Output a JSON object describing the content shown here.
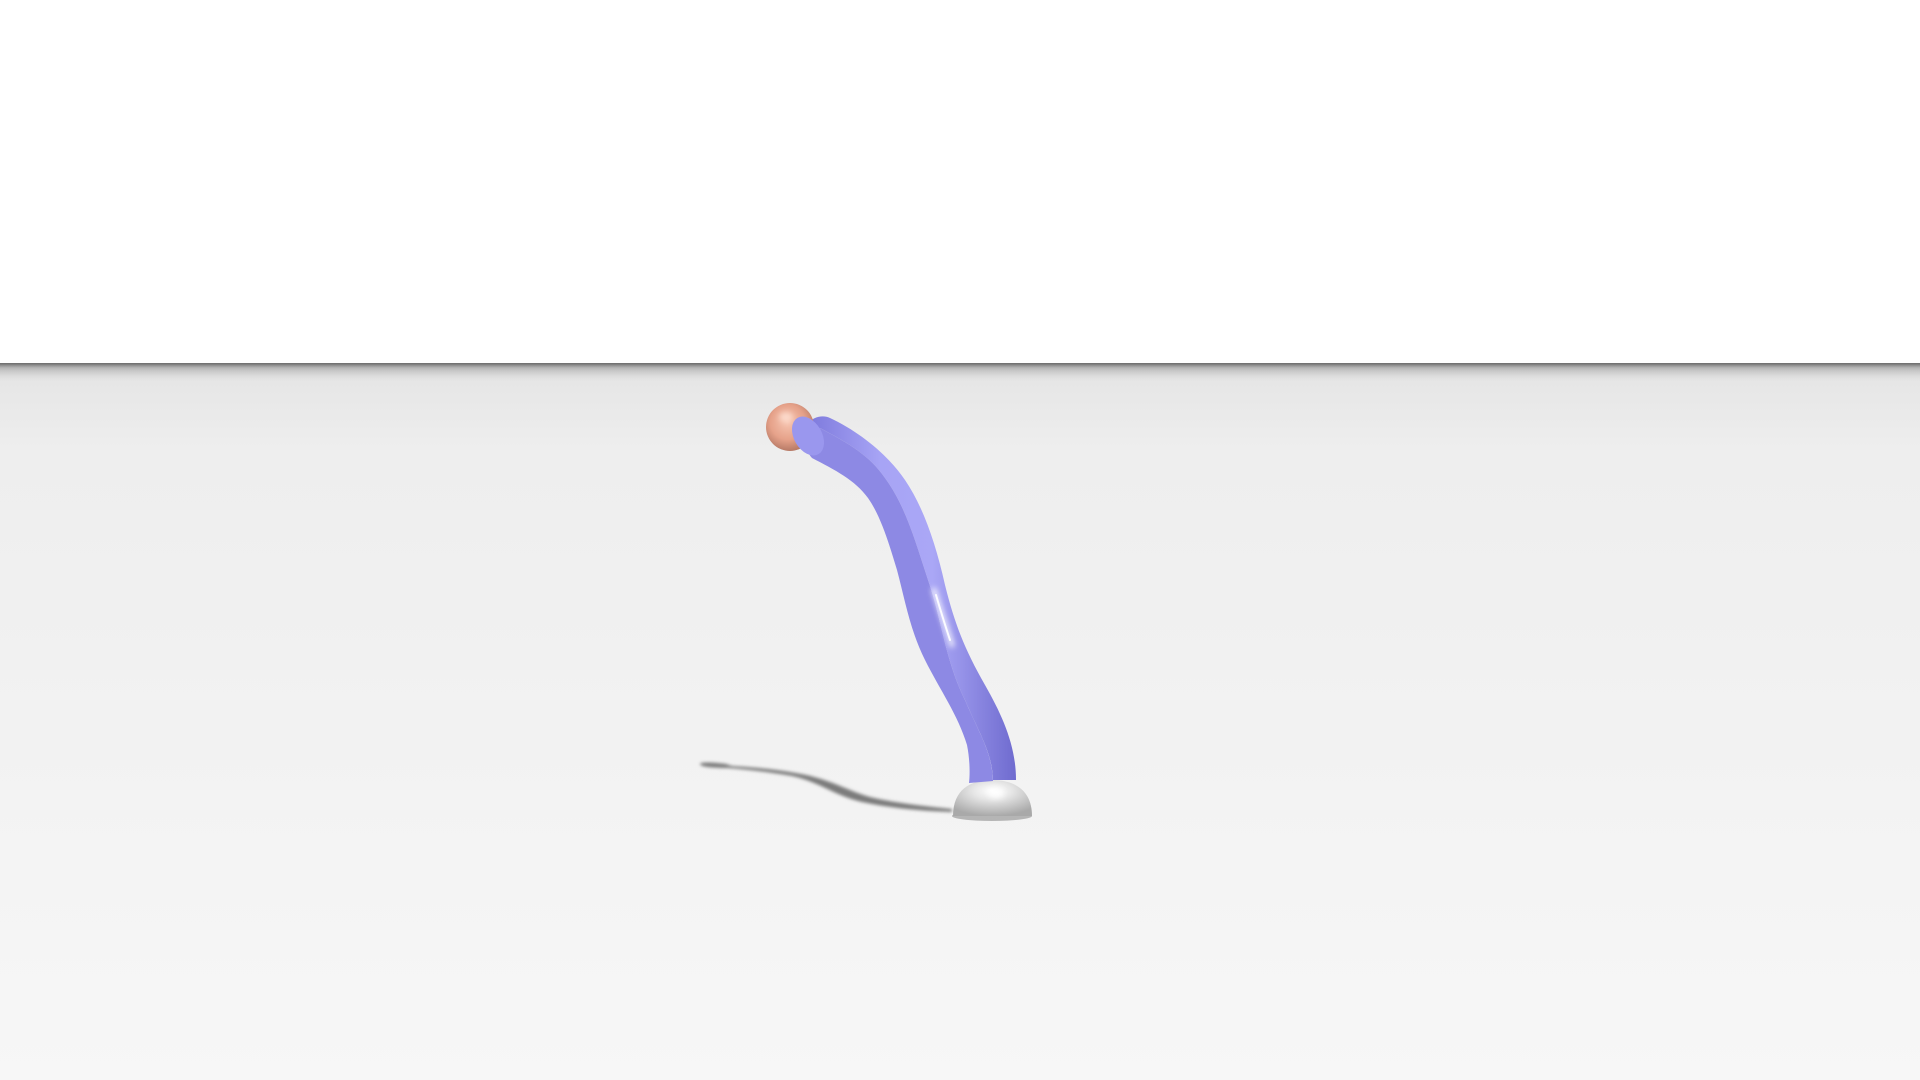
{
  "scene": {
    "description_free": true,
    "colors": {
      "sky": "#ffffff",
      "floor_far": "#e6e6e6",
      "floor_near": "#f7f7f7",
      "horizon_shadow": "#5a5a5a",
      "tube": "#a29ff2",
      "tube_dark": "#6e6ad0",
      "tube_highlight": "#e6e4ff",
      "tip_sphere": "#e8a890",
      "base_dome": "#d9d9d9",
      "cast_shadow": "#707070"
    },
    "icons": {
      "tube": "soft-robot-arm-icon",
      "tip": "tip-sphere-icon",
      "base": "base-dome-icon"
    }
  }
}
